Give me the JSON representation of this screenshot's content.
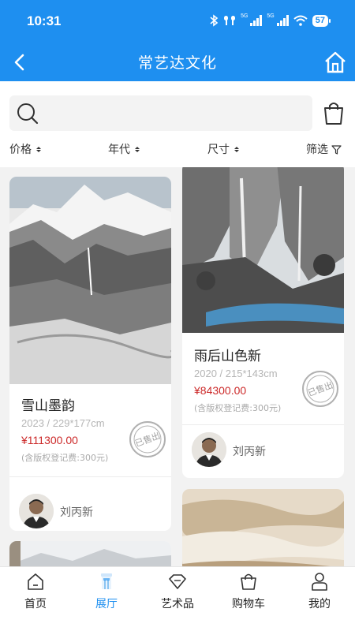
{
  "status_bar": {
    "time": "10:31",
    "signal_tag": "5G",
    "battery": "57"
  },
  "header": {
    "title": "常艺达文化"
  },
  "search": {
    "placeholder": ""
  },
  "filters": [
    {
      "label": "价格"
    },
    {
      "label": "年代"
    },
    {
      "label": "尺寸"
    },
    {
      "label": "筛选"
    }
  ],
  "cards": [
    {
      "name": "雪山墨韵",
      "meta": "2023 / 229*177cm",
      "price": "¥111300.00",
      "fee": "(含版权登记费:300元)",
      "artist": "刘丙新",
      "stamp": "已售出"
    },
    {
      "name": "雨后山色新",
      "meta": "2020 / 215*143cm",
      "price": "¥84300.00",
      "fee": "(含版权登记费:300元)",
      "artist": "刘丙新",
      "stamp": "已售出"
    }
  ],
  "nav": [
    {
      "label": "首页",
      "icon": "home-icon"
    },
    {
      "label": "展厅",
      "icon": "gallery-icon",
      "active": true
    },
    {
      "label": "艺术品",
      "icon": "diamond-icon"
    },
    {
      "label": "购物车",
      "icon": "cart-icon"
    },
    {
      "label": "我的",
      "icon": "user-icon"
    }
  ],
  "colors": {
    "brand": "#1e8ff0",
    "price": "#cc2a2a"
  }
}
